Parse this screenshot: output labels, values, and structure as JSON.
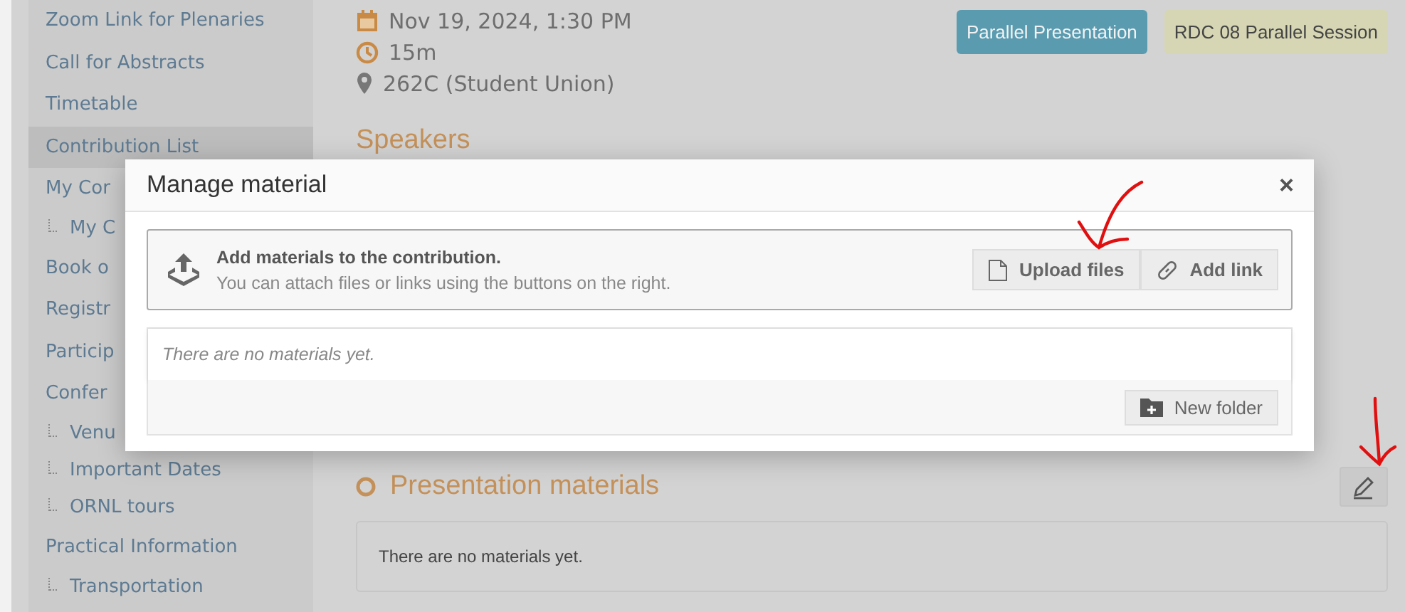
{
  "sidebar": {
    "items": [
      {
        "label": "Zoom Link for Plenaries",
        "sub": false,
        "selected": false
      },
      {
        "label": "Call for Abstracts",
        "sub": false,
        "selected": false
      },
      {
        "label": "Timetable",
        "sub": false,
        "selected": false
      },
      {
        "label": "Contribution List",
        "sub": false,
        "selected": true
      },
      {
        "label": "My Cor",
        "sub": false,
        "selected": false
      },
      {
        "label": "My C",
        "sub": true,
        "selected": false
      },
      {
        "label": "Book o",
        "sub": false,
        "selected": false
      },
      {
        "label": "Registr",
        "sub": false,
        "selected": false
      },
      {
        "label": "Particip",
        "sub": false,
        "selected": false
      },
      {
        "label": "Confer",
        "sub": false,
        "selected": false
      },
      {
        "label": "Venu",
        "sub": true,
        "selected": false
      },
      {
        "label": "Important Dates",
        "sub": true,
        "selected": false
      },
      {
        "label": "ORNL tours",
        "sub": true,
        "selected": false
      },
      {
        "label": "Practical Information",
        "sub": false,
        "selected": false
      },
      {
        "label": "Transportation",
        "sub": true,
        "selected": false
      }
    ]
  },
  "contribution": {
    "date": "Nov 19, 2024, 1:30 PM",
    "duration": "15m",
    "location": "262C (Student Union)",
    "tags": [
      {
        "label": "Parallel Presentation",
        "color": "#5a9bb0"
      },
      {
        "label": "RDC 08 Parallel Session",
        "color": "#d6d6b4"
      }
    ],
    "speakers_heading": "Speakers",
    "materials_heading": "Presentation materials",
    "materials_empty": "There are no materials yet."
  },
  "dialog": {
    "title": "Manage material",
    "close": "×",
    "intro_title": "Add materials to the contribution.",
    "intro_text": "You can attach files or links using the buttons on the right.",
    "upload_button": "Upload files",
    "link_button": "Add link",
    "empty_text": "There are no materials yet.",
    "folder_button": "New folder"
  }
}
